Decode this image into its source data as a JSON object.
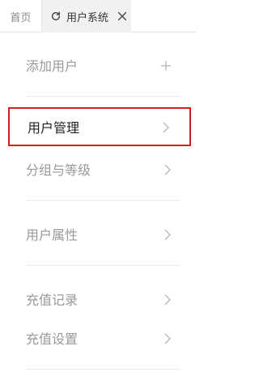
{
  "tabs": {
    "home": "首页",
    "active": "用户系统"
  },
  "menu": {
    "add_user": "添加用户",
    "user_management": "用户管理",
    "groups_levels": "分组与等级",
    "user_attributes": "用户属性",
    "recharge_records": "充值记录",
    "recharge_settings": "充值设置"
  },
  "colors": {
    "selected_border": "#cc2222"
  }
}
